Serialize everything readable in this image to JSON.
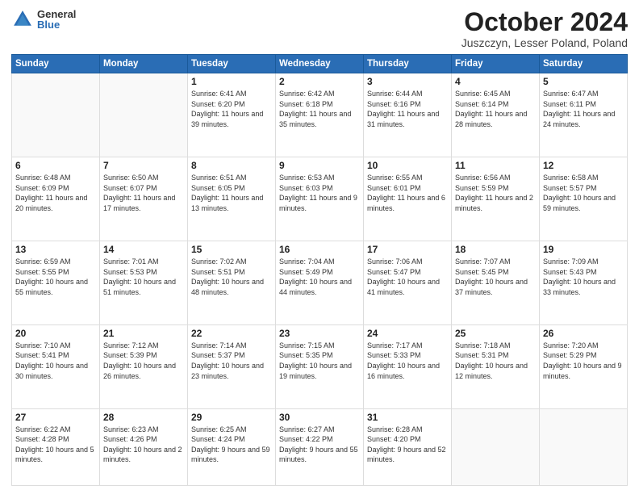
{
  "logo": {
    "general": "General",
    "blue": "Blue"
  },
  "title": "October 2024",
  "location": "Juszczyn, Lesser Poland, Poland",
  "days_of_week": [
    "Sunday",
    "Monday",
    "Tuesday",
    "Wednesday",
    "Thursday",
    "Friday",
    "Saturday"
  ],
  "weeks": [
    [
      {
        "day": "",
        "sunrise": "",
        "sunset": "",
        "daylight": ""
      },
      {
        "day": "",
        "sunrise": "",
        "sunset": "",
        "daylight": ""
      },
      {
        "day": "1",
        "sunrise": "Sunrise: 6:41 AM",
        "sunset": "Sunset: 6:20 PM",
        "daylight": "Daylight: 11 hours and 39 minutes."
      },
      {
        "day": "2",
        "sunrise": "Sunrise: 6:42 AM",
        "sunset": "Sunset: 6:18 PM",
        "daylight": "Daylight: 11 hours and 35 minutes."
      },
      {
        "day": "3",
        "sunrise": "Sunrise: 6:44 AM",
        "sunset": "Sunset: 6:16 PM",
        "daylight": "Daylight: 11 hours and 31 minutes."
      },
      {
        "day": "4",
        "sunrise": "Sunrise: 6:45 AM",
        "sunset": "Sunset: 6:14 PM",
        "daylight": "Daylight: 11 hours and 28 minutes."
      },
      {
        "day": "5",
        "sunrise": "Sunrise: 6:47 AM",
        "sunset": "Sunset: 6:11 PM",
        "daylight": "Daylight: 11 hours and 24 minutes."
      }
    ],
    [
      {
        "day": "6",
        "sunrise": "Sunrise: 6:48 AM",
        "sunset": "Sunset: 6:09 PM",
        "daylight": "Daylight: 11 hours and 20 minutes."
      },
      {
        "day": "7",
        "sunrise": "Sunrise: 6:50 AM",
        "sunset": "Sunset: 6:07 PM",
        "daylight": "Daylight: 11 hours and 17 minutes."
      },
      {
        "day": "8",
        "sunrise": "Sunrise: 6:51 AM",
        "sunset": "Sunset: 6:05 PM",
        "daylight": "Daylight: 11 hours and 13 minutes."
      },
      {
        "day": "9",
        "sunrise": "Sunrise: 6:53 AM",
        "sunset": "Sunset: 6:03 PM",
        "daylight": "Daylight: 11 hours and 9 minutes."
      },
      {
        "day": "10",
        "sunrise": "Sunrise: 6:55 AM",
        "sunset": "Sunset: 6:01 PM",
        "daylight": "Daylight: 11 hours and 6 minutes."
      },
      {
        "day": "11",
        "sunrise": "Sunrise: 6:56 AM",
        "sunset": "Sunset: 5:59 PM",
        "daylight": "Daylight: 11 hours and 2 minutes."
      },
      {
        "day": "12",
        "sunrise": "Sunrise: 6:58 AM",
        "sunset": "Sunset: 5:57 PM",
        "daylight": "Daylight: 10 hours and 59 minutes."
      }
    ],
    [
      {
        "day": "13",
        "sunrise": "Sunrise: 6:59 AM",
        "sunset": "Sunset: 5:55 PM",
        "daylight": "Daylight: 10 hours and 55 minutes."
      },
      {
        "day": "14",
        "sunrise": "Sunrise: 7:01 AM",
        "sunset": "Sunset: 5:53 PM",
        "daylight": "Daylight: 10 hours and 51 minutes."
      },
      {
        "day": "15",
        "sunrise": "Sunrise: 7:02 AM",
        "sunset": "Sunset: 5:51 PM",
        "daylight": "Daylight: 10 hours and 48 minutes."
      },
      {
        "day": "16",
        "sunrise": "Sunrise: 7:04 AM",
        "sunset": "Sunset: 5:49 PM",
        "daylight": "Daylight: 10 hours and 44 minutes."
      },
      {
        "day": "17",
        "sunrise": "Sunrise: 7:06 AM",
        "sunset": "Sunset: 5:47 PM",
        "daylight": "Daylight: 10 hours and 41 minutes."
      },
      {
        "day": "18",
        "sunrise": "Sunrise: 7:07 AM",
        "sunset": "Sunset: 5:45 PM",
        "daylight": "Daylight: 10 hours and 37 minutes."
      },
      {
        "day": "19",
        "sunrise": "Sunrise: 7:09 AM",
        "sunset": "Sunset: 5:43 PM",
        "daylight": "Daylight: 10 hours and 33 minutes."
      }
    ],
    [
      {
        "day": "20",
        "sunrise": "Sunrise: 7:10 AM",
        "sunset": "Sunset: 5:41 PM",
        "daylight": "Daylight: 10 hours and 30 minutes."
      },
      {
        "day": "21",
        "sunrise": "Sunrise: 7:12 AM",
        "sunset": "Sunset: 5:39 PM",
        "daylight": "Daylight: 10 hours and 26 minutes."
      },
      {
        "day": "22",
        "sunrise": "Sunrise: 7:14 AM",
        "sunset": "Sunset: 5:37 PM",
        "daylight": "Daylight: 10 hours and 23 minutes."
      },
      {
        "day": "23",
        "sunrise": "Sunrise: 7:15 AM",
        "sunset": "Sunset: 5:35 PM",
        "daylight": "Daylight: 10 hours and 19 minutes."
      },
      {
        "day": "24",
        "sunrise": "Sunrise: 7:17 AM",
        "sunset": "Sunset: 5:33 PM",
        "daylight": "Daylight: 10 hours and 16 minutes."
      },
      {
        "day": "25",
        "sunrise": "Sunrise: 7:18 AM",
        "sunset": "Sunset: 5:31 PM",
        "daylight": "Daylight: 10 hours and 12 minutes."
      },
      {
        "day": "26",
        "sunrise": "Sunrise: 7:20 AM",
        "sunset": "Sunset: 5:29 PM",
        "daylight": "Daylight: 10 hours and 9 minutes."
      }
    ],
    [
      {
        "day": "27",
        "sunrise": "Sunrise: 6:22 AM",
        "sunset": "Sunset: 4:28 PM",
        "daylight": "Daylight: 10 hours and 5 minutes."
      },
      {
        "day": "28",
        "sunrise": "Sunrise: 6:23 AM",
        "sunset": "Sunset: 4:26 PM",
        "daylight": "Daylight: 10 hours and 2 minutes."
      },
      {
        "day": "29",
        "sunrise": "Sunrise: 6:25 AM",
        "sunset": "Sunset: 4:24 PM",
        "daylight": "Daylight: 9 hours and 59 minutes."
      },
      {
        "day": "30",
        "sunrise": "Sunrise: 6:27 AM",
        "sunset": "Sunset: 4:22 PM",
        "daylight": "Daylight: 9 hours and 55 minutes."
      },
      {
        "day": "31",
        "sunrise": "Sunrise: 6:28 AM",
        "sunset": "Sunset: 4:20 PM",
        "daylight": "Daylight: 9 hours and 52 minutes."
      },
      {
        "day": "",
        "sunrise": "",
        "sunset": "",
        "daylight": ""
      },
      {
        "day": "",
        "sunrise": "",
        "sunset": "",
        "daylight": ""
      }
    ]
  ]
}
